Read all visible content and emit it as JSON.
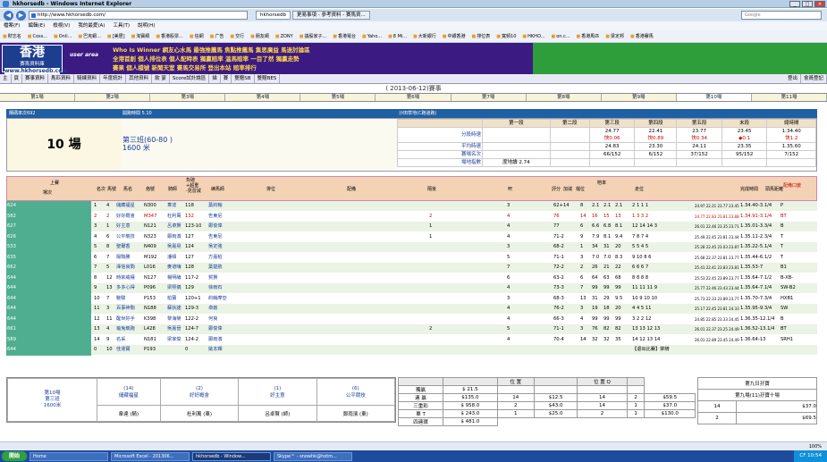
{
  "window": {
    "title": "hkhorsedb - Windows Internet Explorer"
  },
  "browser": {
    "address": "http://www.hkhorsedb.com/",
    "tabs": [
      "hkhorsedb",
      "更易事項 - 參考資料 - 賽馬資..."
    ],
    "search_placeholder": "Google",
    "menu": [
      "檔案(F)",
      "編輯(E)",
      "檢視(V)",
      "我的最愛(A)",
      "工具(T)",
      "說明(H)"
    ],
    "favorites": [
      "財忘名",
      "Coss...",
      "Onli...",
      "巴克銀...",
      "[美居]",
      "淘寶網",
      "香港股票...",
      "信網",
      "广告",
      "交行",
      "朋友網",
      "ZONY",
      "議股家子...",
      "香港電台",
      "Yaho...",
      "8 Mi...",
      "大新銀行",
      "中銀香港",
      "排位表",
      "寬頻10",
      "HKHO...",
      "on.c...",
      "香港馬匹",
      "梁定邦",
      "香港賽馬"
    ]
  },
  "banner": {
    "logo_big": "香港",
    "logo_sub": "賽馬資料庫",
    "logo_url": "www.hkhorsedb.com",
    "user_area": "user area",
    "lines": [
      "Who Is Winner 網友心水馬  最強推薦馬 焦點推薦馬  集思廣益 馬迷討論區",
      "全港首創 個人排位表  個人配時表  獨贏賠率   溫馬賠率  一目了然 獨贏走勢",
      "賽果  個人檔號  新聞天室  賽馬交易所  登出本站  賠率排行"
    ]
  },
  "sitenav": {
    "items": [
      "主",
      "頁",
      "賽事資料",
      "馬匹資料",
      "騎練資料",
      "年度統計",
      "其他資料",
      "飲  宴",
      "Score試計論區",
      "描",
      "賽",
      "雙贈SB",
      "雙贈BES"
    ],
    "logout": "登出",
    "member": "會員登記"
  },
  "race_date": "( 2013-06-12)賽事",
  "race_tabs": [
    "第1場",
    "第2場",
    "第3場",
    "第4場",
    "第5場",
    "第6場",
    "第7場",
    "第8場",
    "第9場",
    "第10場",
    "第11場"
  ],
  "race_header": {
    "left": "購碼率次692",
    "mid": "開跑時間 5.10",
    "right": "沙田草地(C跑道跑)"
  },
  "race": {
    "number": "10 場",
    "class": "第三班(60-80 )",
    "distance": "1600 米"
  },
  "sectional": {
    "headers": [
      "第一段",
      "第二段",
      "第三段",
      "第四段",
      "第五段",
      "末段",
      "總時間"
    ],
    "rows": [
      {
        "label": "分段時速",
        "values": [
          "",
          "",
          "24.77\n快0.06",
          "22.41\n快0.89",
          "23.77\n快0.34",
          "23.45\n◆0.1",
          "1:34.40\n快1.2"
        ]
      },
      {
        "label": "平均時速",
        "values": [
          "",
          "",
          "24.83",
          "23.30",
          "24.11",
          "23.35",
          "1.35.60"
        ]
      },
      {
        "label": "賽場名次",
        "values": [
          "",
          "",
          "66/152",
          "6/152",
          "37/152",
          "95/152",
          "7/152"
        ]
      },
      {
        "label": "場地指數",
        "values": [
          "度地讀 2.74",
          "",
          "",
          "",
          "",
          "",
          ""
        ]
      }
    ]
  },
  "table_headers": [
    "上賽",
    "場次",
    "名次",
    "馬號",
    "馬名",
    "烙號",
    "騎師",
    "負磅\n+超重\n-見習減",
    "練馬師",
    "排位",
    "配備",
    "隔後",
    "呎",
    "評分",
    "加減",
    "檔位",
    "賠率",
    "走位",
    "完成時間",
    "頭馬距離",
    "配備口變"
  ],
  "runners": [
    {
      "race": "624",
      "pos": "1",
      "no": "4",
      "name": "儲藏福星",
      "brand": "N300",
      "jockey": "韋達",
      "wt": "118",
      "trainer": "葉約翰",
      "gear": "",
      "odds_col": "3",
      "rating": "62+14",
      "draw": "8",
      "o1": "2.1",
      "o2": "2.1",
      "o3": "2.1",
      "run": "2  1  1  1",
      "sec": "24.97 22.21 23.77 23.45",
      "time": "1.34.40",
      "margin": "-3.1/4",
      "cg": "P",
      "red": false
    },
    {
      "race": "582",
      "pos": "2",
      "no": "2",
      "name": "好好概會",
      "brand": "M347",
      "jockey": "杜利萬",
      "wt": "132",
      "trainer": "告東尼",
      "gear": "2",
      "odds_col": "4",
      "rating": "76",
      "draw": "14",
      "o1": "16",
      "o2": "15",
      "o3": "13",
      "run": "1  3  3  2",
      "sec": "24.77 22.83 23.81 23.88",
      "time": "1.34.91",
      "margin": "-3.1/4",
      "cg": "BT",
      "red": true
    },
    {
      "race": "627",
      "pos": "3",
      "no": "1",
      "name": "好主意",
      "brand": "N121",
      "jockey": "呂卓賢",
      "wt": "123-10",
      "trainer": "鄭俊偉",
      "gear": "1",
      "odds_col": "4",
      "rating": "77",
      "draw": "6",
      "o1": "6.6",
      "o2": "6.8",
      "o3": "8.1",
      "run": "12 14 14  3",
      "sec": "26.01 22.46 23.35 23.71",
      "time": "1.35.01",
      "margin": "-3.3/4",
      "cg": "B",
      "red": false
    },
    {
      "race": "626",
      "pos": "4",
      "no": "6",
      "name": "公平競技",
      "brand": "N323",
      "jockey": "鄭雨濱",
      "wt": "127",
      "trainer": "告東尼",
      "gear": "1",
      "odds_col": "4",
      "rating": "71-2",
      "draw": "9",
      "o1": "7.9",
      "o2": "8.1",
      "o3": "9.4",
      "run": "7  8  7  4",
      "sec": "25.49 22.45 23.81 23.44",
      "time": "1.35.11",
      "margin": "-2.3/4",
      "cg": "T",
      "red": false
    },
    {
      "race": "533",
      "pos": "5",
      "no": "8",
      "name": "聖爾香",
      "brand": "N409",
      "jockey": "吳嘉晃",
      "wt": "124",
      "trainer": "吳定強",
      "gear": "",
      "odds_col": "3",
      "rating": "68-2",
      "draw": "1",
      "o1": "34",
      "o2": "31",
      "o3": "20",
      "run": "5  5  4  5",
      "sec": "25.28 22.45 23.03 23.87",
      "time": "1.35.22",
      "margin": "-5.1/4",
      "cg": "T",
      "red": false
    },
    {
      "race": "635",
      "pos": "6",
      "no": "7",
      "name": "陽駒勝",
      "brand": "M192",
      "jockey": "潘頓",
      "wt": "127",
      "trainer": "方嘉柏",
      "gear": "",
      "odds_col": "5",
      "rating": "71-1",
      "draw": "3",
      "o1": "7.0",
      "o2": "7.0",
      "o3": "8.3",
      "run": "9  10  8  6",
      "sec": "25.68 22.37 23.81 23.77",
      "time": "1.35.44",
      "margin": "-6.1/2",
      "cg": "T",
      "red": false
    },
    {
      "race": "662",
      "pos": "7",
      "no": "5",
      "name": "澤信良駒",
      "brand": "L016",
      "jockey": "麥道嗨",
      "wt": "128",
      "trainer": "葉楚航",
      "gear": "",
      "odds_col": "7",
      "rating": "72-2",
      "draw": "2",
      "o1": "26",
      "o2": "21",
      "o3": "22",
      "run": "6  6  6  7",
      "sec": "25.41 22.41 23.83 23.81",
      "time": "1.35.53",
      "margin": "-7",
      "cg": "B1",
      "red": false
    },
    {
      "race": "644",
      "pos": "8",
      "no": "12",
      "name": "時來威權",
      "brand": "N127",
      "jockey": "楊明綸",
      "wt": "117-2",
      "trainer": "賀賢",
      "gear": "",
      "odds_col": "6",
      "rating": "63-2",
      "draw": "6",
      "o1": "64",
      "o2": "63",
      "o3": "68",
      "run": "8  8  8  8",
      "sec": "25.53 22.45 23.89 23.77",
      "time": "1.35.64",
      "margin": "-7.1/2",
      "cg": "B-XB-",
      "red": false
    },
    {
      "race": "644",
      "pos": "9",
      "no": "13",
      "name": "多多心得",
      "brand": "P096",
      "jockey": "梁熙儀",
      "wt": "129",
      "trainer": "徐雨石",
      "gear": "",
      "odds_col": "4",
      "rating": "73-3",
      "draw": "7",
      "o1": "99",
      "o2": "99",
      "o3": "99",
      "run": "11 11 11  9",
      "sec": "25.77 22.46 23.43 23.44",
      "time": "1.35.64",
      "margin": "-7.1/4",
      "cg": "SW-B2",
      "red": false
    },
    {
      "race": "644",
      "pos": "10",
      "no": "7",
      "name": "馳駿",
      "brand": "P153",
      "jockey": "柏寶",
      "wt": "120+1",
      "trainer": "約翰摩亞",
      "gear": "",
      "odds_col": "3",
      "rating": "68-3",
      "draw": "13",
      "o1": "31",
      "o2": "29",
      "o3": "9.5",
      "run": "10  9  10 10",
      "sec": "25.73 22.33 23.89 23.77",
      "time": "1.35.70",
      "margin": "-7.3/4",
      "cg": "HXB1",
      "red": false
    },
    {
      "race": "644",
      "pos": "11",
      "no": "3",
      "name": "百事神駒",
      "brand": "N188",
      "jockey": "蘇狄諾",
      "wt": "129-3",
      "trainer": "卓啟",
      "gear": "",
      "odds_col": "4",
      "rating": "76-2",
      "draw": "3",
      "o1": "19",
      "o2": "18",
      "o3": "20",
      "run": "4  4  5 11",
      "sec": "25.17 22.45 23.81 24.33",
      "time": "1.35.95",
      "margin": "-9.3/4",
      "cg": "SW",
      "red": false
    },
    {
      "race": "644",
      "pos": "12",
      "no": "11",
      "name": "醒世好手",
      "brand": "K398",
      "jockey": "黎海榮",
      "wt": "122-2",
      "trainer": "何良",
      "gear": "",
      "odds_col": "4",
      "rating": "66-3",
      "draw": "4",
      "o1": "99",
      "o2": "99",
      "o3": "99",
      "run": "3  2  2 12",
      "sec": "24.85 22.85 23.33 24.45",
      "time": "1.36.35",
      "margin": "-12.1/4",
      "cg": "B",
      "red": false
    },
    {
      "race": "661",
      "pos": "13",
      "no": "4",
      "name": "龜兔競跑",
      "brand": "L428",
      "jockey": "吳嘉晉",
      "wt": "124-7",
      "trainer": "鄭俊偉",
      "gear": "2",
      "odds_col": "5",
      "rating": "71-1",
      "draw": "3",
      "o1": "76",
      "o2": "82",
      "o3": "82",
      "run": "13 13 12 13",
      "sec": "26.01 22.37 23.25 24.49",
      "time": "1.36.52",
      "margin": "-13.1/4",
      "cg": "BT",
      "red": false
    },
    {
      "race": "589",
      "pos": "14",
      "no": "9",
      "name": "名采",
      "brand": "N181",
      "jockey": "梁家俊",
      "wt": "124-2",
      "trainer": "鄭雨濱",
      "gear": "",
      "odds_col": "4",
      "rating": "70-4",
      "draw": "14",
      "o1": "32",
      "o2": "32",
      "o3": "35",
      "run": "14 12 13 14",
      "sec": "26.01 22.89 23.45 24.49",
      "time": "1.36.64",
      "margin": "-13",
      "cg": "SRH1",
      "red": false
    },
    {
      "race": "644",
      "pos": "0",
      "no": "10",
      "name": "佳運寶",
      "brand": "P193",
      "jockey": "",
      "wt": "0",
      "trainer": "姚本輝",
      "gear": "",
      "odds_col": "",
      "rating": "",
      "draw": "",
      "o1": "",
      "o2": "",
      "o3": "",
      "run": "【退出比賽】禁騎",
      "sec": "",
      "time": "",
      "margin": "",
      "cg": "",
      "red": false
    }
  ],
  "summary": {
    "race": "第10場\n第三班\n1600米",
    "top4": [
      {
        "num": "(14)",
        "name": "儲藏福星",
        "jockey": "韋達 (騎)"
      },
      {
        "num": "(2)",
        "name": "好好概會",
        "jockey": "杜利萬 (東)"
      },
      {
        "num": "(1)",
        "name": "好主意",
        "jockey": "呂卓賢 (師)"
      },
      {
        "num": "(6)",
        "name": "公平競技",
        "jockey": "鄭雨濱 (東)"
      }
    ]
  },
  "dividends": {
    "header": [
      "",
      "",
      "位 置",
      "",
      "位 置 Q",
      ""
    ],
    "rows": [
      [
        "獨贏",
        "$ 21.5",
        "",
        "",
        "",
        ""
      ],
      [
        "連  贏",
        "$135.0",
        "14",
        "$12.5",
        "14",
        "2",
        "$59.5"
      ],
      [
        "三重彩",
        "$ 958.0",
        "2",
        "$43.0",
        "14",
        "1",
        "$37.0"
      ],
      [
        "單  T",
        "$ 243.0",
        "1",
        "$25.0",
        "2",
        "1",
        "$130.0"
      ],
      [
        "四連環",
        "$ 481.0"
      ]
    ]
  },
  "jackpot": {
    "title": "第九日孖寶",
    "sub": "第九場(11)孖寶十場",
    "rows": [
      [
        "14",
        "$37.0"
      ],
      [
        "2",
        "$69.5"
      ]
    ]
  },
  "statusbar": {
    "zoom": "100%"
  },
  "taskbar": {
    "start": "開始",
    "items": [
      "Home",
      "Microsoft Excel - 201306...",
      "hkhorsedb - Window...",
      "Skype™ - snowhk@hotm...",
      "CF"
    ],
    "time": "10:54"
  }
}
